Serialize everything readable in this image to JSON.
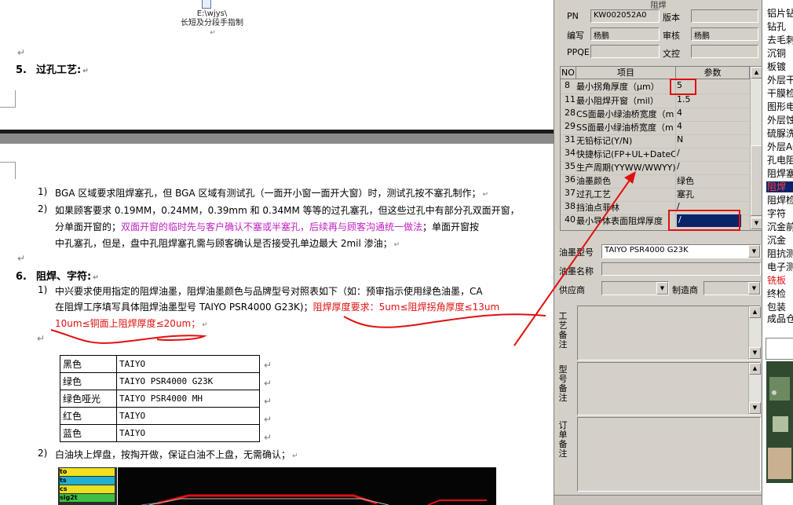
{
  "doc": {
    "file_caption_line1": "E:\\wjys\\",
    "file_caption_line2": "长短及分段手指制",
    "heading5": {
      "num": "5.",
      "text": "过孔工艺:"
    },
    "item_bga_num": "1)",
    "item_bga": "BGA 区域要求阻焊塞孔，但 BGA 区域有测试孔（一面开小窗一面开大窗）时，测试孔按不塞孔制作；",
    "item_via_num": "2)",
    "item_via_line1": "如果顾客要求 0.19MM，0.24MM，0.39mm 和 0.34MM 等等的过孔塞孔，但这些过孔中有部分孔双面开窗，",
    "item_via_line2_a": "分单面开窗的；",
    "item_via_line2_purple": "双面开窗的临时先与客户确认不塞或半塞孔，后续再与顾客沟通统一做法",
    "item_via_line2_b": "；单面开窗按",
    "item_via_line3": "中孔塞孔，但是，盘中孔阻焊塞孔需与顾客确认是否接受孔单边最大 2mil 渗油；",
    "heading6": {
      "num": "6.",
      "text": "阻焊、字符:"
    },
    "item_ink_num": "1)",
    "item_ink_line1": "中兴要求使用指定的阻焊油墨，阻焊油墨颜色与品牌型号对照表如下（如：预审指示使用绿色油墨，CA",
    "item_ink_line2_a": "在阻焊工序填写具体阻焊油墨型号 TAIYO   PSR4000 G23K)；",
    "item_ink_line2_red": "阻焊厚度要求：5um≤阻焊拐角厚度≤13um",
    "item_ink_line3_red": "10um≤铜面上阻焊厚度≤20um；",
    "ink_table": [
      [
        "黑色",
        "TAIYO"
      ],
      [
        "绿色",
        "TAIYO    PSR4000 G23K"
      ],
      [
        "绿色哑光",
        "TAIYO    PSR4000 MH"
      ],
      [
        "红色",
        "TAIYO"
      ],
      [
        "蓝色",
        "TAIYO"
      ]
    ],
    "item_white_num": "2)",
    "item_white": "白油块上焊盘，按掏开做，保证白油不上盘，无需确认；",
    "pcb_layers": [
      "to",
      "ts",
      "cs",
      "sig2t"
    ]
  },
  "app": {
    "title": "阻焊",
    "pn_label": "PN",
    "pn_value": "KW002052A0",
    "version_label": "版本",
    "version_value": "",
    "editor_label": "编写",
    "editor_value": "杨鹏",
    "reviewer_label": "审核",
    "reviewer_value": "杨鹏",
    "ppqe_label": "PPQE",
    "ppqe_value": "",
    "wenkong_label": "文控",
    "wenkong_value": "",
    "grid_headers": {
      "no": "NO",
      "item": "项目",
      "param": "参数"
    },
    "grid_rows": [
      {
        "no": "8",
        "item": "最小拐角厚度（μm）",
        "param": "5"
      },
      {
        "no": "11",
        "item": "最小阻焊开窗（mil）",
        "param": "1.5"
      },
      {
        "no": "28",
        "item": "CS面最小绿油桥宽度（m",
        "param": "4"
      },
      {
        "no": "29",
        "item": "SS面最小绿油桥宽度（m",
        "param": "4"
      },
      {
        "no": "31",
        "item": "无铅标记(Y/N)",
        "param": "N"
      },
      {
        "no": "34",
        "item": "快捷标记(FP+UL+DateCo",
        "param": "/"
      },
      {
        "no": "35",
        "item": "生产周期(YYWW/WWYY)",
        "param": "/"
      },
      {
        "no": "36",
        "item": "油墨颜色",
        "param": "绿色"
      },
      {
        "no": "37",
        "item": "过孔工艺",
        "param": "塞孔"
      },
      {
        "no": "38",
        "item": "挡油点菲林",
        "param": "/"
      },
      {
        "no": "40",
        "item": "最小导体表面阻焊厚度",
        "param": "/"
      }
    ],
    "ink_model_label": "油墨型号",
    "ink_model_value": "TAIYO  PSR4000 G23K",
    "ink_name_label": "油墨名称",
    "ink_name_value": "",
    "supplier_label": "供应商",
    "supplier_value": "",
    "maker_label": "制造商",
    "maker_value": "",
    "memo_process": "工艺备注",
    "memo_model": "型号备注",
    "memo_order": "订单备注"
  },
  "rlist": {
    "items": [
      "铝片钻",
      "钻孔",
      "去毛刺",
      "沉铜",
      "板镀",
      "外层干",
      "干膜检",
      "图形电",
      "外层蚀",
      "硫脲洗",
      "外层AO",
      "孔电阻",
      "阻焊塞",
      "阻焊",
      "阻焊检",
      "字符",
      "沉金前",
      "沉金",
      "阻抗测",
      "电子测",
      "铣板",
      "终检",
      "包装",
      "成品仓"
    ],
    "selected_index": 13,
    "red_index": 20
  },
  "colors": {
    "selection": "#0a246a",
    "annotation_red": "#e01010",
    "purple_text": "#c020c0"
  }
}
